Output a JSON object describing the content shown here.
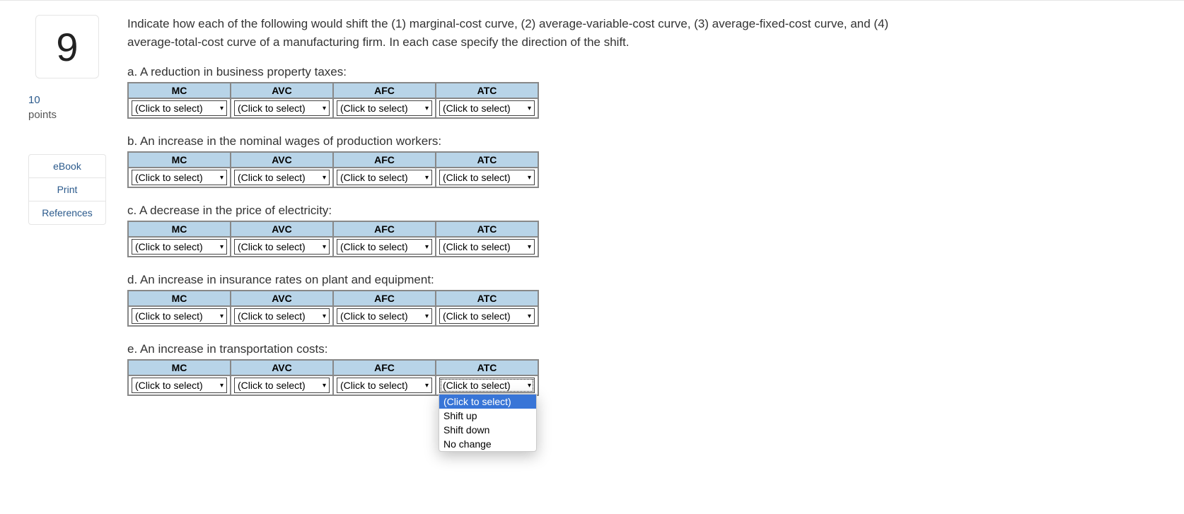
{
  "question_number": "9",
  "points_value": "10",
  "points_label": "points",
  "sidebar_links": [
    "eBook",
    "Print",
    "References"
  ],
  "prompt": "Indicate how each of the following would shift the (1) marginal-cost curve, (2) average-variable-cost curve, (3) average-fixed-cost curve, and (4) average-total-cost curve of a manufacturing firm. In each case specify the direction of the shift.",
  "columns": [
    "MC",
    "AVC",
    "AFC",
    "ATC"
  ],
  "select_placeholder": "(Click to select)",
  "subquestions": [
    {
      "id": "a",
      "label": "a. A reduction in business property taxes:"
    },
    {
      "id": "b",
      "label": "b. An increase in the nominal wages of production workers:"
    },
    {
      "id": "c",
      "label": "c. A decrease in the price of electricity:"
    },
    {
      "id": "d",
      "label": "d. An increase in insurance rates on plant and equipment:"
    },
    {
      "id": "e",
      "label": "e. An increase in transportation costs:"
    }
  ],
  "dropdown_options": [
    "(Click to select)",
    "Shift up",
    "Shift down",
    "No change"
  ]
}
